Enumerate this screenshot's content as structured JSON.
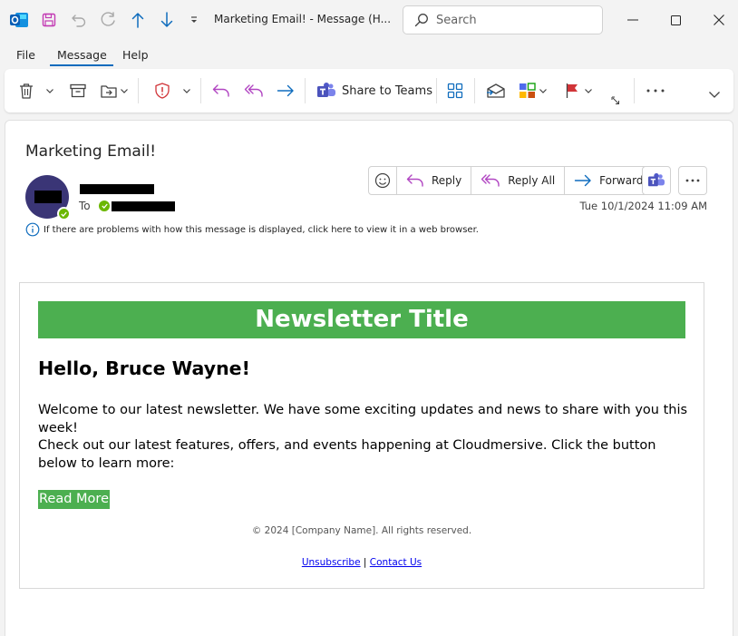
{
  "window": {
    "title": "Marketing Email!  -  Message (H...",
    "search_placeholder": "Search"
  },
  "menu": {
    "tabs": [
      "File",
      "Message",
      "Help"
    ],
    "active": "Message"
  },
  "ribbon": {
    "share_teams_label": "Share to Teams"
  },
  "message": {
    "subject": "Marketing Email!",
    "to_label": "To",
    "info_text": "If there are problems with how this message is displayed, click here to view it in a web browser.",
    "date": "Tue 10/1/2024 11:09 AM",
    "actions": {
      "reply": "Reply",
      "reply_all": "Reply All",
      "forward": "Forward"
    }
  },
  "email": {
    "newsletter_title": "Newsletter Title",
    "greeting": "Hello, Bruce Wayne!",
    "paragraph1": "Welcome to our latest newsletter. We have some exciting updates and news to share with you this week!",
    "paragraph2": "Check out our latest features, offers, and events happening at Cloudmersive. Click the button below to learn more:",
    "read_more": "Read More",
    "copyright": "© 2024 [Company Name]. All rights reserved.",
    "unsubscribe": "Unsubscribe",
    "separator": "|",
    "contact": "Contact Us"
  },
  "colors": {
    "accent": "#0f6cbd",
    "newsletter_green": "#4caf50",
    "avatar": "#3a3576",
    "presence": "#6bb700"
  }
}
